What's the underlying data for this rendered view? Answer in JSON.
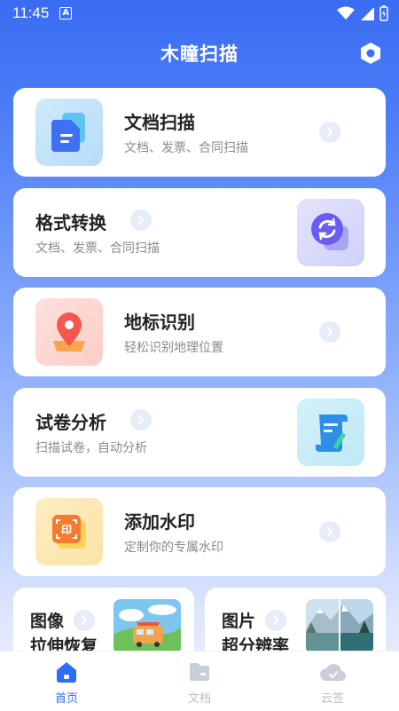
{
  "status_bar": {
    "time": "11:45",
    "badge": "A"
  },
  "header": {
    "title": "木瞳扫描"
  },
  "cards": [
    {
      "title": "文档扫描",
      "subtitle": "文档、发票、合同扫描",
      "icon": "document-icon"
    },
    {
      "title": "格式转换",
      "subtitle": "文档、发票、合同扫描",
      "icon": "convert-icon"
    },
    {
      "title": "地标识别",
      "subtitle": "轻松识别地理位置",
      "icon": "location-pin-icon"
    },
    {
      "title": "试卷分析",
      "subtitle": "扫描试卷，自动分析",
      "icon": "scroll-pen-icon"
    },
    {
      "title": "添加水印",
      "subtitle": "定制你的专属水印",
      "icon": "stamp-icon"
    }
  ],
  "half_cards": [
    {
      "line1": "图像",
      "line2": "拉伸恢复",
      "image": "bus-landscape-thumbnail"
    },
    {
      "line1": "图片",
      "line2": "超分辨率",
      "image": "mountain-lake-thumbnail"
    }
  ],
  "tabs": [
    {
      "label": "首页",
      "active": true,
      "icon": "home-icon"
    },
    {
      "label": "文档",
      "active": false,
      "icon": "folder-icon"
    },
    {
      "label": "云签",
      "active": false,
      "icon": "cloud-icon"
    }
  ],
  "colors": {
    "accent": "#2f6df6",
    "inactive": "#b8bdc8"
  }
}
